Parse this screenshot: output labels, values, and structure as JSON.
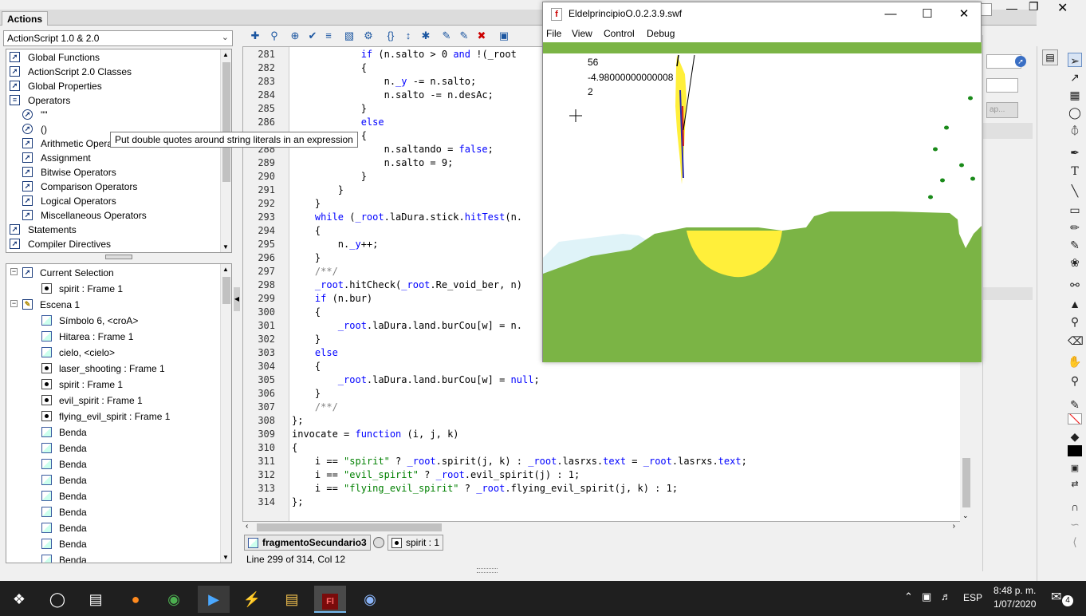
{
  "panel": {
    "tab": "Actions",
    "dropdown": "ActionScript 1.0 & 2.0"
  },
  "toolbox": [
    {
      "label": "Global Functions",
      "indent": 0,
      "icon": "book"
    },
    {
      "label": "ActionScript 2.0 Classes",
      "indent": 0,
      "icon": "book"
    },
    {
      "label": "Global Properties",
      "indent": 0,
      "icon": "book"
    },
    {
      "label": "Operators",
      "indent": 0,
      "icon": "open-book"
    },
    {
      "label": "\"\"",
      "indent": 1,
      "icon": "circle"
    },
    {
      "label": "()",
      "indent": 1,
      "icon": "circle"
    },
    {
      "label": "Arithmetic Operators",
      "indent": 1,
      "icon": "book"
    },
    {
      "label": "Assignment",
      "indent": 1,
      "icon": "book"
    },
    {
      "label": "Bitwise Operators",
      "indent": 1,
      "icon": "book"
    },
    {
      "label": "Comparison Operators",
      "indent": 1,
      "icon": "book"
    },
    {
      "label": "Logical Operators",
      "indent": 1,
      "icon": "book"
    },
    {
      "label": "Miscellaneous Operators",
      "indent": 1,
      "icon": "book"
    },
    {
      "label": "Statements",
      "indent": 0,
      "icon": "book"
    },
    {
      "label": "Compiler Directives",
      "indent": 0,
      "icon": "book"
    }
  ],
  "tooltip": "Put double quotes around string literals in an expression",
  "script_nav": [
    {
      "label": "Current Selection",
      "level": 0,
      "icon": "book",
      "expander": "−"
    },
    {
      "label": "spirit : Frame 1",
      "level": 1,
      "icon": "frame"
    },
    {
      "label": "Escena 1",
      "level": 0,
      "icon": "scene",
      "expander": "−"
    },
    {
      "label": "Símbolo 6, <croA>",
      "level": 1,
      "icon": "sym"
    },
    {
      "label": "Hitarea : Frame 1",
      "level": 1,
      "icon": "sym"
    },
    {
      "label": "cielo, <cielo>",
      "level": 1,
      "icon": "sym"
    },
    {
      "label": "laser_shooting : Frame 1",
      "level": 1,
      "icon": "frame"
    },
    {
      "label": "spirit : Frame 1",
      "level": 1,
      "icon": "frame"
    },
    {
      "label": "evil_spirit : Frame 1",
      "level": 1,
      "icon": "frame"
    },
    {
      "label": "flying_evil_spirit : Frame 1",
      "level": 1,
      "icon": "frame"
    },
    {
      "label": "Benda",
      "level": 1,
      "icon": "sym"
    },
    {
      "label": "Benda",
      "level": 1,
      "icon": "sym"
    },
    {
      "label": "Benda",
      "level": 1,
      "icon": "sym"
    },
    {
      "label": "Benda",
      "level": 1,
      "icon": "sym"
    },
    {
      "label": "Benda",
      "level": 1,
      "icon": "sym"
    },
    {
      "label": "Benda",
      "level": 1,
      "icon": "sym"
    },
    {
      "label": "Benda",
      "level": 1,
      "icon": "sym"
    },
    {
      "label": "Benda",
      "level": 1,
      "icon": "sym"
    },
    {
      "label": "Benda",
      "level": 1,
      "icon": "sym"
    }
  ],
  "code_lines": [
    {
      "n": "281",
      "html": "            <span class=\"kw\">if</span> (n.salto &gt; 0 <span class=\"kw\">and</span> !(_root"
    },
    {
      "n": "282",
      "html": "            {"
    },
    {
      "n": "283",
      "html": "                n.<span class=\"prop\">_y</span> -= n.salto;"
    },
    {
      "n": "284",
      "html": "                n.salto -= n.desAc;"
    },
    {
      "n": "285",
      "html": "            }"
    },
    {
      "n": "286",
      "html": "            <span class=\"kw\">else</span>"
    },
    {
      "n": "287",
      "html": "            {"
    },
    {
      "n": "288",
      "html": "                n.saltando = <span class=\"kw\">false</span>;"
    },
    {
      "n": "289",
      "html": "                n.salto = 9;"
    },
    {
      "n": "290",
      "html": "            }"
    },
    {
      "n": "291",
      "html": "        }"
    },
    {
      "n": "292",
      "html": "    }"
    },
    {
      "n": "293",
      "html": "    <span class=\"kw\">while</span> (<span class=\"prop\">_root</span>.laDura.stick.<span class=\"prop\">hitTest</span>(n."
    },
    {
      "n": "294",
      "html": "    {"
    },
    {
      "n": "295",
      "html": "        n.<span class=\"prop\">_y</span>++;"
    },
    {
      "n": "296",
      "html": "    }"
    },
    {
      "n": "297",
      "html": "    <span class=\"cmt\">/**/</span>"
    },
    {
      "n": "298",
      "html": "    <span class=\"prop\">_root</span>.hitCheck(<span class=\"prop\">_root</span>.Re_void_ber, n)"
    },
    {
      "n": "299",
      "html": "    <span class=\"kw\">if</span> (n.bur)"
    },
    {
      "n": "300",
      "html": "    {"
    },
    {
      "n": "301",
      "html": "        <span class=\"prop\">_root</span>.laDura.land.burCou[w] = n."
    },
    {
      "n": "302",
      "html": "    }"
    },
    {
      "n": "303",
      "html": "    <span class=\"kw\">else</span>"
    },
    {
      "n": "304",
      "html": "    {"
    },
    {
      "n": "305",
      "html": "        <span class=\"prop\">_root</span>.laDura.land.burCou[w] = <span class=\"kw\">null</span>;"
    },
    {
      "n": "306",
      "html": "    }"
    },
    {
      "n": "307",
      "html": "    <span class=\"cmt\">/**/</span>"
    },
    {
      "n": "308",
      "html": "};"
    },
    {
      "n": "309",
      "html": "invocate = <span class=\"kw\">function</span> (i, j, k)"
    },
    {
      "n": "310",
      "html": "{"
    },
    {
      "n": "311",
      "html": "    i == <span class=\"str\">\"spirit\"</span> ? <span class=\"prop\">_root</span>.spirit(j, k) : <span class=\"prop\">_root</span>.lasrxs.<span class=\"prop\">text</span> = <span class=\"prop\">_root</span>.lasrxs.<span class=\"prop\">text</span>;"
    },
    {
      "n": "312",
      "html": "    i == <span class=\"str\">\"evil_spirit\"</span> ? <span class=\"prop\">_root</span>.evil_spirit(j) : 1;"
    },
    {
      "n": "313",
      "html": "    i == <span class=\"str\">\"flying_evil_spirit\"</span> ? <span class=\"prop\">_root</span>.flying_evil_spirit(j, k) : 1;"
    },
    {
      "n": "314",
      "html": "};"
    }
  ],
  "bottom_tabs": {
    "active": "fragmentoSecundario3",
    "other": "spirit : 1"
  },
  "status": "Line 299 of 314, Col 12",
  "swf": {
    "title": "EldelprincipioO.0.2.3.9.swf",
    "menus": [
      "File",
      "View",
      "Control",
      "Debug"
    ],
    "readouts": [
      "56",
      "-4.98000000000008",
      "2"
    ]
  },
  "taskbar": {
    "time": "8:48 p. m.",
    "date": "1/07/2020",
    "lang": "ESP",
    "notifications": "4"
  }
}
